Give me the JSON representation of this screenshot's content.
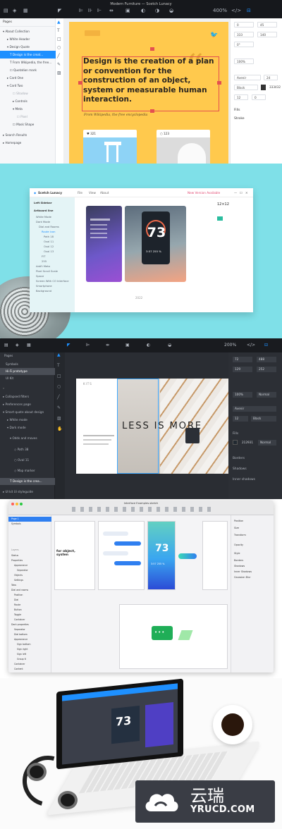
{
  "shot1": {
    "window_title": "Modern Furniture — Scetch Lunacy",
    "zoom": "400%",
    "pages_header": "Pages",
    "layers": [
      "About Collection",
      "White Header",
      "Design Quote",
      "Design is the creat...",
      "From Wikipedia, the free...",
      "Quotation mark",
      "Card One",
      "Card Two",
      "Shadow",
      "Controls",
      "Meta",
      "Pixel",
      "Mask Shape",
      "Search Results",
      "Homepage"
    ],
    "quote_text": "Design is the creation of a plan or convention for the construction of an object, system or measurable human interaction.",
    "quote_source": "From Wikipedia, the free encyclopedia",
    "card1_count": "321",
    "card2_count": "123",
    "props": {
      "x": "0",
      "y": "45",
      "w": "333",
      "h": "140",
      "rotation": "0°",
      "opacity": "100%",
      "font": "Avenir",
      "size": "24",
      "weight": "Black",
      "color": "333432",
      "line": "12",
      "spacing": "0"
    },
    "fills_label": "Fills",
    "stroke_label": "Stroke"
  },
  "shot2": {
    "app_title": "Scetch Lunacy",
    "menus": [
      "File",
      "View",
      "About"
    ],
    "new_version": "New Version Available",
    "left_title": "Left Sidebar",
    "group_title": "Artboard line",
    "items": [
      "White Mode",
      "Dark Mode",
      "Dial and Rooms",
      "Route icon",
      "Path 18",
      "Oval 11",
      "Oval 12",
      "Oval 13",
      "FIT",
      "255",
      "Add't Meta",
      "Pixel Scroll Scale",
      "Space",
      "Screen With CO Interface",
      "Smartphone",
      "Background"
    ],
    "big_number": "73",
    "stats": [
      "3:57",
      "255",
      "%"
    ],
    "right_size": "12×12",
    "zoom": "2022"
  },
  "shot3": {
    "zoom": "200%",
    "pages_header": "Pages",
    "layers": [
      "Symbols",
      "Hi-Fi prototype",
      "UI Kit",
      "Collapsed filters",
      "Preferences page",
      "Smart quote about design",
      "White mode",
      "Dark mode",
      "Odds and moves",
      "Path 38",
      "Oval 11",
      "Map marker",
      "Design is the crea...",
      "UI kit Ui styleguide"
    ],
    "headline": "LESS IS MORE",
    "brand": "KITS",
    "props": {
      "x": "72",
      "y": "129",
      "w": "488",
      "h": "252",
      "opacity": "100%",
      "blend": "Normal",
      "font": "Avenir",
      "size": "12",
      "weight": "Black",
      "fill_color": "212931",
      "fill_blend": "Normal"
    },
    "sections": [
      "Fills",
      "Borders",
      "Shadows",
      "Inner shadows"
    ]
  },
  "shot4": {
    "window_title": "Interface Examples.sketch",
    "big_number": "73",
    "stats": [
      "3:57",
      "255",
      "%"
    ],
    "left_items": [
      "Page 1",
      "Symbols",
      "Layers",
      "Status",
      "Properties",
      "Appearance",
      "Separator",
      "Objects",
      "Settings",
      "Tabs",
      "Dial and rooms",
      "Position",
      "Dial",
      "Route",
      "Button",
      "Toggle",
      "Container",
      "Dark properties",
      "Separator",
      "Dial bottom",
      "Appearance",
      "Sign bottom",
      "Sign right",
      "Sign left",
      "Group 6",
      "Container",
      "Content"
    ],
    "right_items": [
      "Position",
      "Size",
      "Transform",
      "Opacity",
      "Style",
      "Borders",
      "Shadows",
      "Inner Shadows",
      "Gaussian Blur"
    ],
    "note": "for object, systen"
  },
  "shot5": {
    "watermark_cn": "云瑞",
    "watermark_url": "YRUCD.COM",
    "screen_number": "73"
  },
  "colors": {
    "yellow": "#ffc94d",
    "accent": "#1e90ff",
    "cyan": "#7fe0e8",
    "dark": "#25282d"
  }
}
